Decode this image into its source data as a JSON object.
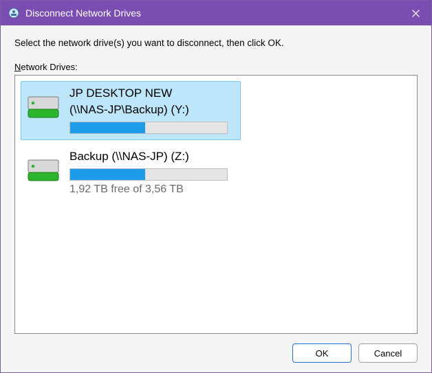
{
  "window": {
    "title": "Disconnect Network Drives"
  },
  "instruction": "Select the network drive(s) you want to disconnect, then click OK.",
  "list_label_pre": "N",
  "list_label_rest": "etwork Drives:",
  "drives": [
    {
      "line1": "JP DESKTOP NEW",
      "line2": "(\\\\NAS-JP\\Backup) (Y:)",
      "usage_percent": 48,
      "free_text": "",
      "selected": true
    },
    {
      "line1": "Backup (\\\\NAS-JP) (Z:)",
      "line2": "",
      "usage_percent": 48,
      "free_text": "1,92 TB free of 3,56 TB",
      "selected": false
    }
  ],
  "buttons": {
    "ok": "OK",
    "cancel": "Cancel"
  }
}
